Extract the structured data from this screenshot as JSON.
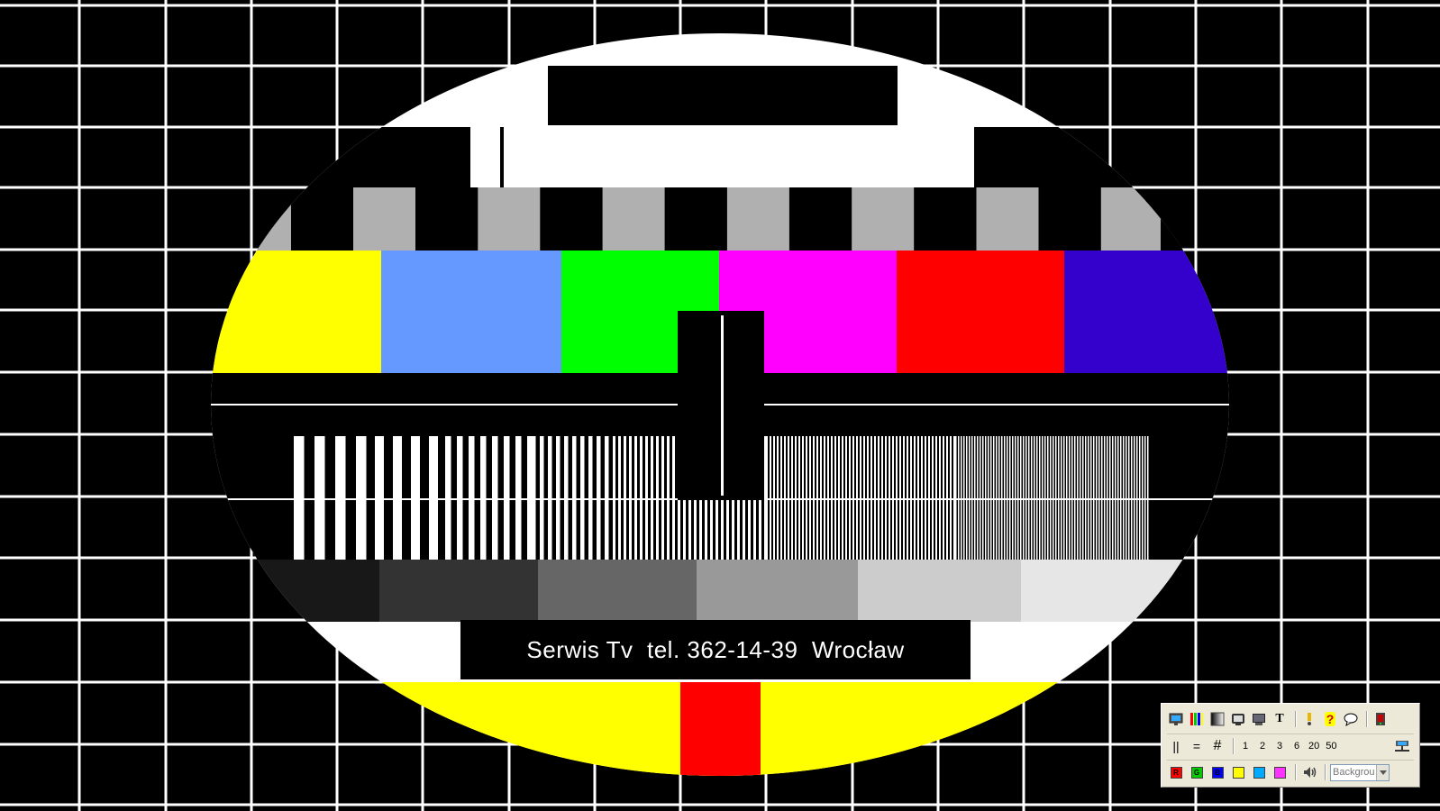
{
  "caption": "Serwis Tv  tel. 362-14-39  Wrocław",
  "colors": {
    "background": "#000000",
    "grid": "#ffffff",
    "disc": "#ffffff",
    "gray_block": "#b0b0b0",
    "color_bars": [
      "#ffff00",
      "#6699ff",
      "#00ff00",
      "#ff00ff",
      "#ff0000",
      "#3300cc"
    ],
    "gray_steps": [
      "#181818",
      "#333333",
      "#666666",
      "#999999",
      "#cccccc",
      "#e6e6e6"
    ],
    "bottom_yellow": "#ffff00",
    "bottom_red": "#ff0000"
  },
  "toolbar": {
    "row1": [
      {
        "name": "monitor-icon",
        "symbol": "monitor"
      },
      {
        "name": "color-bars-icon",
        "symbol": "bars"
      },
      {
        "name": "gradient-icon",
        "symbol": "gradient"
      },
      {
        "name": "tv-icon",
        "symbol": "tv"
      },
      {
        "name": "display-icon",
        "symbol": "display"
      },
      {
        "name": "text-icon",
        "symbol": "T"
      },
      {
        "name": "info-icon",
        "symbol": "info"
      },
      {
        "name": "help-icon",
        "symbol": "?"
      },
      {
        "name": "speech-icon",
        "symbol": "speech"
      },
      {
        "name": "exit-icon",
        "symbol": "exit"
      }
    ],
    "row2_lines": [
      "||",
      "=",
      "#"
    ],
    "row2_numbers": [
      "1",
      "2",
      "3",
      "6",
      "20",
      "50"
    ],
    "row2_right_icon": "network-icon",
    "row3_colors": [
      {
        "label": "R",
        "color": "#ff0000"
      },
      {
        "label": "G",
        "color": "#00cc00"
      },
      {
        "label": "B",
        "color": "#0000ff"
      },
      {
        "label": "",
        "color": "#ffff00"
      },
      {
        "label": "",
        "color": "#00aaff"
      },
      {
        "label": "",
        "color": "#ff33ff"
      }
    ],
    "row3_sound_icon": "speaker-icon",
    "background_select": {
      "value": "Backgrou",
      "arrow_icon": "chevron-down-icon"
    }
  }
}
